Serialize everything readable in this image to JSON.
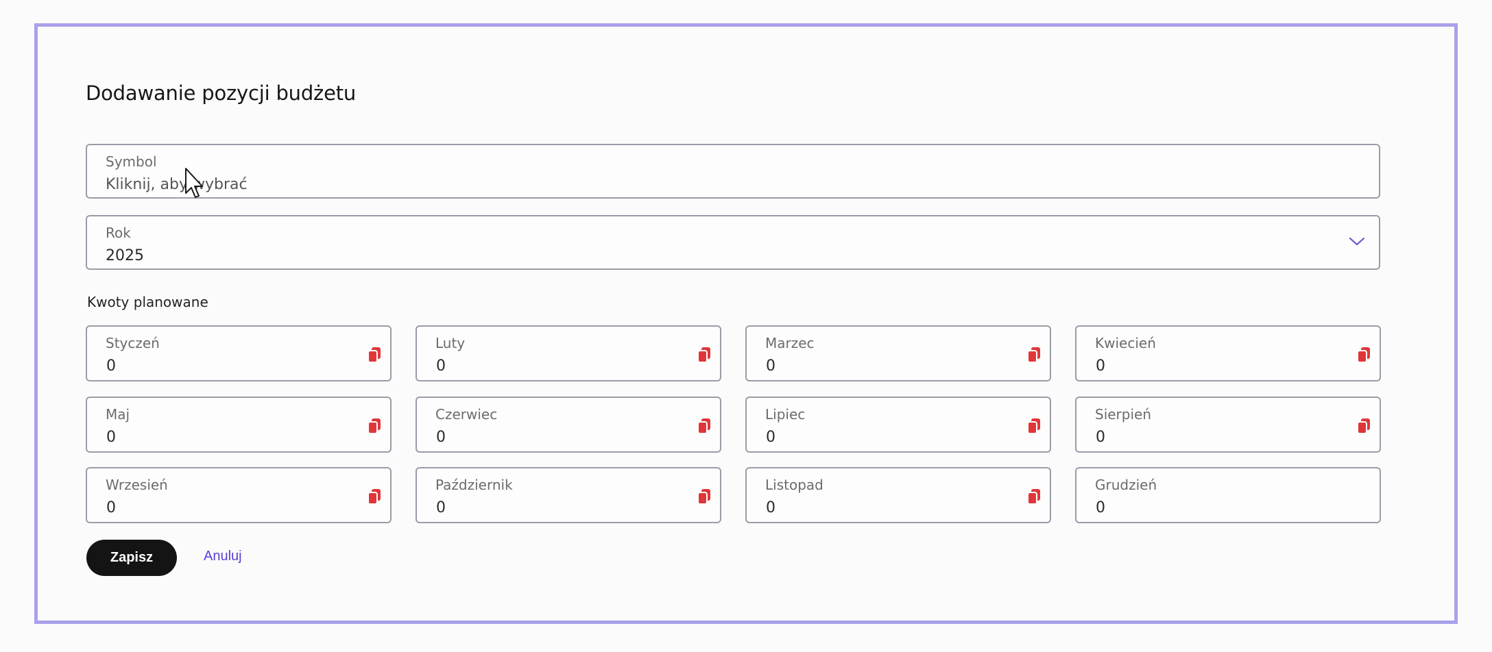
{
  "form": {
    "title": "Dodawanie pozycji budżetu",
    "symbol": {
      "label": "Symbol",
      "placeholder": "Kliknij, aby wybrać"
    },
    "year": {
      "label": "Rok",
      "value": "2025"
    },
    "section_label": "Kwoty planowane",
    "months": [
      {
        "label": "Styczeń",
        "value": "0",
        "copy": true
      },
      {
        "label": "Luty",
        "value": "0",
        "copy": true
      },
      {
        "label": "Marzec",
        "value": "0",
        "copy": true
      },
      {
        "label": "Kwiecień",
        "value": "0",
        "copy": true
      },
      {
        "label": "Maj",
        "value": "0",
        "copy": true
      },
      {
        "label": "Czerwiec",
        "value": "0",
        "copy": true
      },
      {
        "label": "Lipiec",
        "value": "0",
        "copy": true
      },
      {
        "label": "Sierpień",
        "value": "0",
        "copy": true
      },
      {
        "label": "Wrzesień",
        "value": "0",
        "copy": true
      },
      {
        "label": "Październik",
        "value": "0",
        "copy": true
      },
      {
        "label": "Listopad",
        "value": "0",
        "copy": true
      },
      {
        "label": "Grudzień",
        "value": "0",
        "copy": false
      }
    ],
    "save_label": "Zapisz",
    "cancel_label": "Anuluj"
  },
  "icons": {
    "copy": "copy-icon",
    "chevron": "chevron-down-icon",
    "cursor": "mouse-cursor-icon"
  },
  "colors": {
    "frame_border": "#a9a0ec",
    "accent": "#5b3fd6",
    "copy_icon": "#e0363a",
    "save_button": "#141414"
  }
}
